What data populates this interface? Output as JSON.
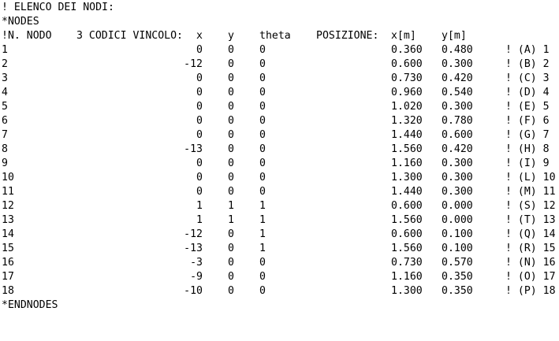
{
  "header": {
    "comment": "! ELENCO DEI NODI:",
    "keyword": "*NODES",
    "columns": {
      "node": "!N. NODO",
      "codes": "3 CODICI VINCOLO:",
      "x": "x",
      "y": "y",
      "theta": "theta",
      "position": "POSIZIONE:",
      "xm": "x[m]",
      "ym": "y[m]"
    }
  },
  "nodes": [
    {
      "n": "1",
      "cx": "0",
      "cy": "0",
      "ct": "0",
      "x": "0.360",
      "y": "0.480",
      "label": "! (A) 1"
    },
    {
      "n": "2",
      "cx": "-12",
      "cy": "0",
      "ct": "0",
      "x": "0.600",
      "y": "0.300",
      "label": "! (B) 2"
    },
    {
      "n": "3",
      "cx": "0",
      "cy": "0",
      "ct": "0",
      "x": "0.730",
      "y": "0.420",
      "label": "! (C) 3"
    },
    {
      "n": "4",
      "cx": "0",
      "cy": "0",
      "ct": "0",
      "x": "0.960",
      "y": "0.540",
      "label": "! (D) 4"
    },
    {
      "n": "5",
      "cx": "0",
      "cy": "0",
      "ct": "0",
      "x": "1.020",
      "y": "0.300",
      "label": "! (E) 5"
    },
    {
      "n": "6",
      "cx": "0",
      "cy": "0",
      "ct": "0",
      "x": "1.320",
      "y": "0.780",
      "label": "! (F) 6"
    },
    {
      "n": "7",
      "cx": "0",
      "cy": "0",
      "ct": "0",
      "x": "1.440",
      "y": "0.600",
      "label": "! (G) 7"
    },
    {
      "n": "8",
      "cx": "-13",
      "cy": "0",
      "ct": "0",
      "x": "1.560",
      "y": "0.420",
      "label": "! (H) 8"
    },
    {
      "n": "9",
      "cx": "0",
      "cy": "0",
      "ct": "0",
      "x": "1.160",
      "y": "0.300",
      "label": "! (I) 9"
    },
    {
      "n": "10",
      "cx": "0",
      "cy": "0",
      "ct": "0",
      "x": "1.300",
      "y": "0.300",
      "label": "! (L) 10"
    },
    {
      "n": "11",
      "cx": "0",
      "cy": "0",
      "ct": "0",
      "x": "1.440",
      "y": "0.300",
      "label": "! (M) 11"
    },
    {
      "n": "12",
      "cx": "1",
      "cy": "1",
      "ct": "1",
      "x": "0.600",
      "y": "0.000",
      "label": "! (S) 12"
    },
    {
      "n": "13",
      "cx": "1",
      "cy": "1",
      "ct": "1",
      "x": "1.560",
      "y": "0.000",
      "label": "! (T) 13"
    },
    {
      "n": "14",
      "cx": "-12",
      "cy": "0",
      "ct": "1",
      "x": "0.600",
      "y": "0.100",
      "label": "! (Q) 14"
    },
    {
      "n": "15",
      "cx": "-13",
      "cy": "0",
      "ct": "1",
      "x": "1.560",
      "y": "0.100",
      "label": "! (R) 15"
    },
    {
      "n": "16",
      "cx": "-3",
      "cy": "0",
      "ct": "0",
      "x": "0.730",
      "y": "0.570",
      "label": "! (N) 16"
    },
    {
      "n": "17",
      "cx": "-9",
      "cy": "0",
      "ct": "0",
      "x": "1.160",
      "y": "0.350",
      "label": "! (O) 17"
    },
    {
      "n": "18",
      "cx": "-10",
      "cy": "0",
      "ct": "0",
      "x": "1.300",
      "y": "0.350",
      "label": "! (P) 18"
    }
  ],
  "footer": {
    "keyword": "*ENDNODES"
  }
}
